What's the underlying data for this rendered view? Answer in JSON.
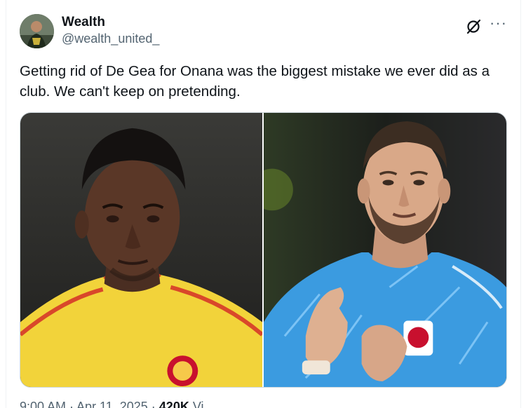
{
  "tweet": {
    "author_name": "Wealth",
    "author_handle": "@wealth_united_",
    "text": "Getting rid of De Gea for Onana was the biggest mistake we ever did as a club. We can't keep on pretending."
  },
  "icons": {
    "grok": "grok-icon",
    "more": "more-options-icon",
    "more_glyph": "···"
  },
  "meta": {
    "partial_text": "9:00 AM · Apr 11, 2025 ·",
    "views_count": "420K",
    "views_label": "Vi"
  },
  "colors": {
    "text_primary": "#0f1419",
    "text_secondary": "#536471",
    "border": "#cfd9de",
    "shirt_yellow": "#f2d33a",
    "shirt_blue": "#3b9be0"
  }
}
